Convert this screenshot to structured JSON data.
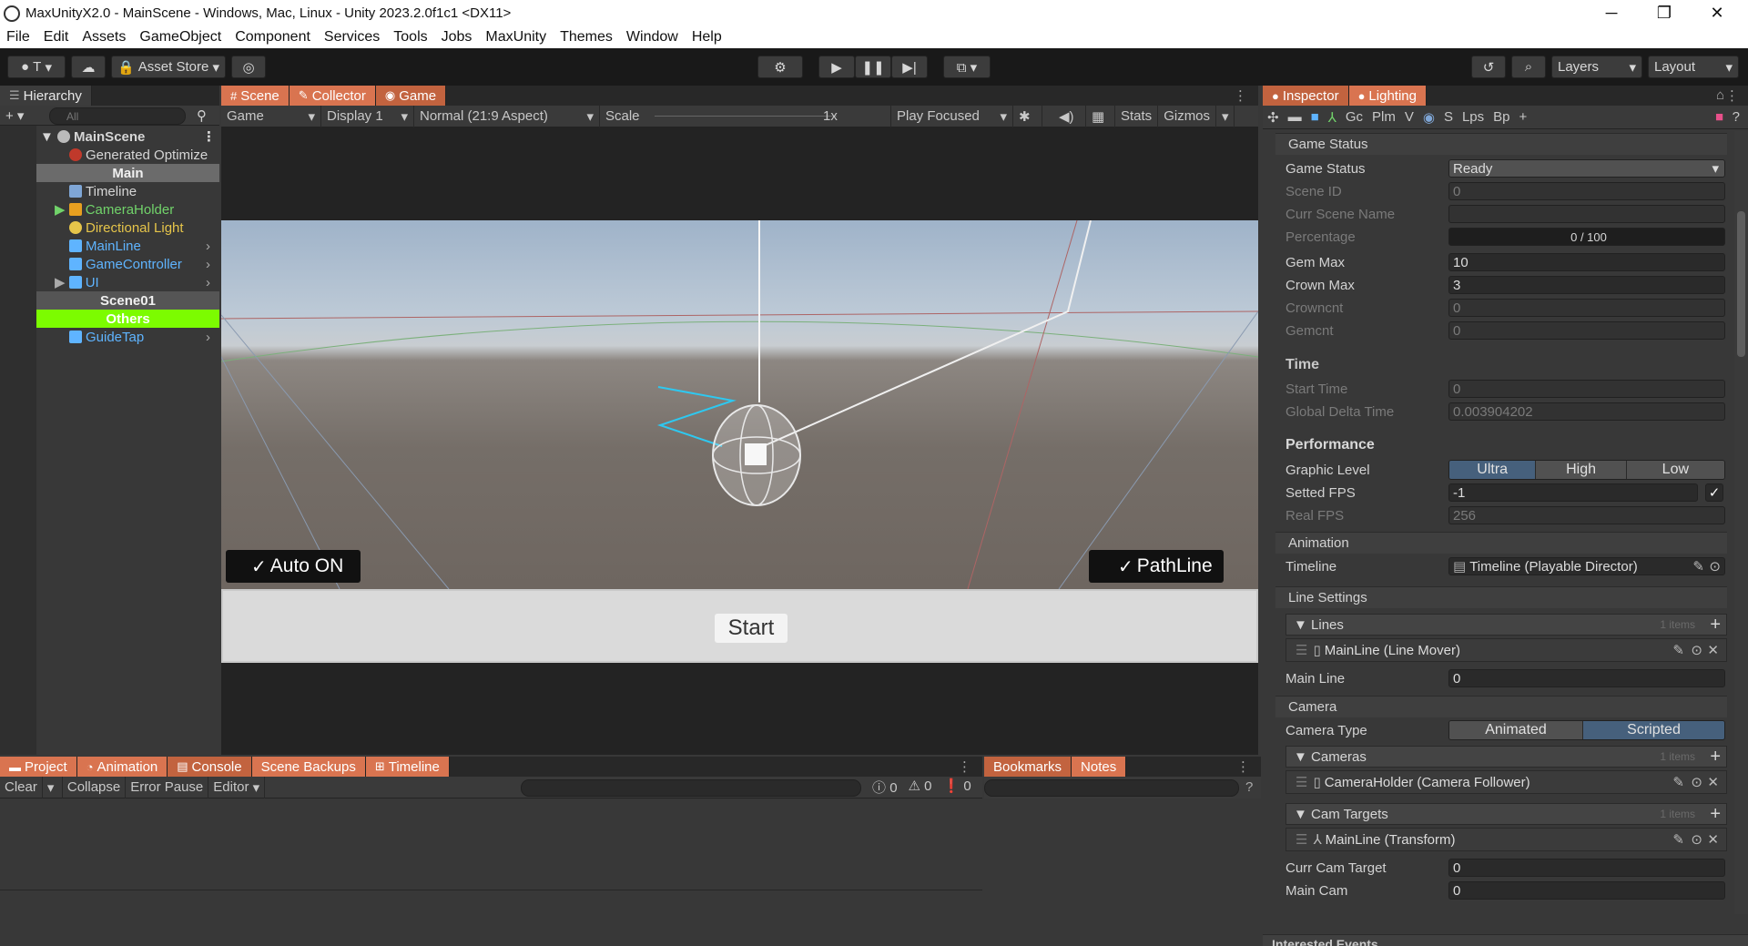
{
  "window": {
    "title": "MaxUnityX2.0 - MainScene - Windows, Mac, Linux - Unity 2023.2.0f1c1 <DX11>",
    "minimize": "─",
    "maximize": "❐",
    "close": "✕"
  },
  "menu": [
    "File",
    "Edit",
    "Assets",
    "GameObject",
    "Component",
    "Services",
    "Tools",
    "Jobs",
    "MaxUnity",
    "Themes",
    "Window",
    "Help"
  ],
  "toolbar": {
    "account": "T",
    "asset_store": "Asset Store",
    "layers": "Layers",
    "layout": "Layout"
  },
  "hierarchy": {
    "tab": "Hierarchy",
    "search_placeholder": "All",
    "items": [
      {
        "label": "MainScene"
      },
      {
        "label": "Generated Optimize"
      },
      {
        "label": "Main"
      },
      {
        "label": "Timeline"
      },
      {
        "label": "CameraHolder"
      },
      {
        "label": "Directional Light"
      },
      {
        "label": "MainLine"
      },
      {
        "label": "GameController"
      },
      {
        "label": "UI"
      },
      {
        "label": "Scene01"
      },
      {
        "label": "Others"
      },
      {
        "label": "GuideTap"
      }
    ]
  },
  "center_tabs": [
    "Scene",
    "Collector",
    "Game"
  ],
  "game_bar": {
    "display_mode": "Game",
    "display": "Display 1",
    "aspect": "Normal (21:9 Aspect)",
    "scale_label": "Scale",
    "scale_value": "1x",
    "play_mode": "Play Focused",
    "stats": "Stats",
    "gizmos": "Gizmos"
  },
  "game_ui": {
    "auto_btn": "Auto ON",
    "pathline_btn": "PathLine",
    "start_btn": "Start"
  },
  "bottom_tabs": [
    "Project",
    "Animation",
    "Console",
    "Scene Backups",
    "Timeline"
  ],
  "bottom_tabs2": [
    "Bookmarks",
    "Notes"
  ],
  "console": {
    "clear": "Clear",
    "collapse": "Collapse",
    "error_pause": "Error Pause",
    "editor": "Editor",
    "count_log": "0",
    "count_warn": "0",
    "count_error": "0"
  },
  "inspector": {
    "tabs": [
      "Inspector",
      "Lighting"
    ],
    "tool_labels": [
      "Gc",
      "Plm",
      "V",
      "S",
      "Lps",
      "Bp"
    ],
    "game_status_header": "Game Status",
    "game_status": {
      "label": "Game Status",
      "value": "Ready"
    },
    "scene_id": {
      "label": "Scene ID",
      "value": "0"
    },
    "curr_scene_name": {
      "label": "Curr Scene Name",
      "value": ""
    },
    "percentage": {
      "label": "Percentage",
      "value": "0 / 100"
    },
    "gem_max": {
      "label": "Gem Max",
      "value": "10"
    },
    "crown_max": {
      "label": "Crown Max",
      "value": "3"
    },
    "crowncnt": {
      "label": "Crowncnt",
      "value": "0"
    },
    "gemcnt": {
      "label": "Gemcnt",
      "value": "0"
    },
    "time_header": "Time",
    "start_time": {
      "label": "Start Time",
      "value": "0"
    },
    "global_delta": {
      "label": "Global Delta Time",
      "value": "0.003904202"
    },
    "perf_header": "Performance",
    "graphic_level": {
      "label": "Graphic Level",
      "options": [
        "Ultra",
        "High",
        "Low"
      ],
      "selected": "Ultra"
    },
    "setted_fps": {
      "label": "Setted FPS",
      "value": "-1"
    },
    "real_fps": {
      "label": "Real FPS",
      "value": "256"
    },
    "anim_header": "Animation",
    "timeline": {
      "label": "Timeline",
      "value": "Timeline (Playable Director)"
    },
    "line_header": "Line Settings",
    "lines": {
      "label": "Lines",
      "count": "1 items",
      "item": "MainLine (Line Mover)"
    },
    "main_line": {
      "label": "Main Line",
      "value": "0"
    },
    "camera_header": "Camera",
    "camera_type": {
      "label": "Camera Type",
      "options": [
        "Animated",
        "Scripted"
      ],
      "selected": "Scripted"
    },
    "cameras": {
      "label": "Cameras",
      "count": "1 items",
      "item": "CameraHolder (Camera Follower)"
    },
    "cam_targets": {
      "label": "Cam Targets",
      "count": "1 items",
      "item": "MainLine (Transform)"
    },
    "curr_cam_target": {
      "label": "Curr Cam Target",
      "value": "0"
    },
    "main_cam": {
      "label": "Main Cam",
      "value": "0"
    },
    "events_header": "Interested Events"
  }
}
